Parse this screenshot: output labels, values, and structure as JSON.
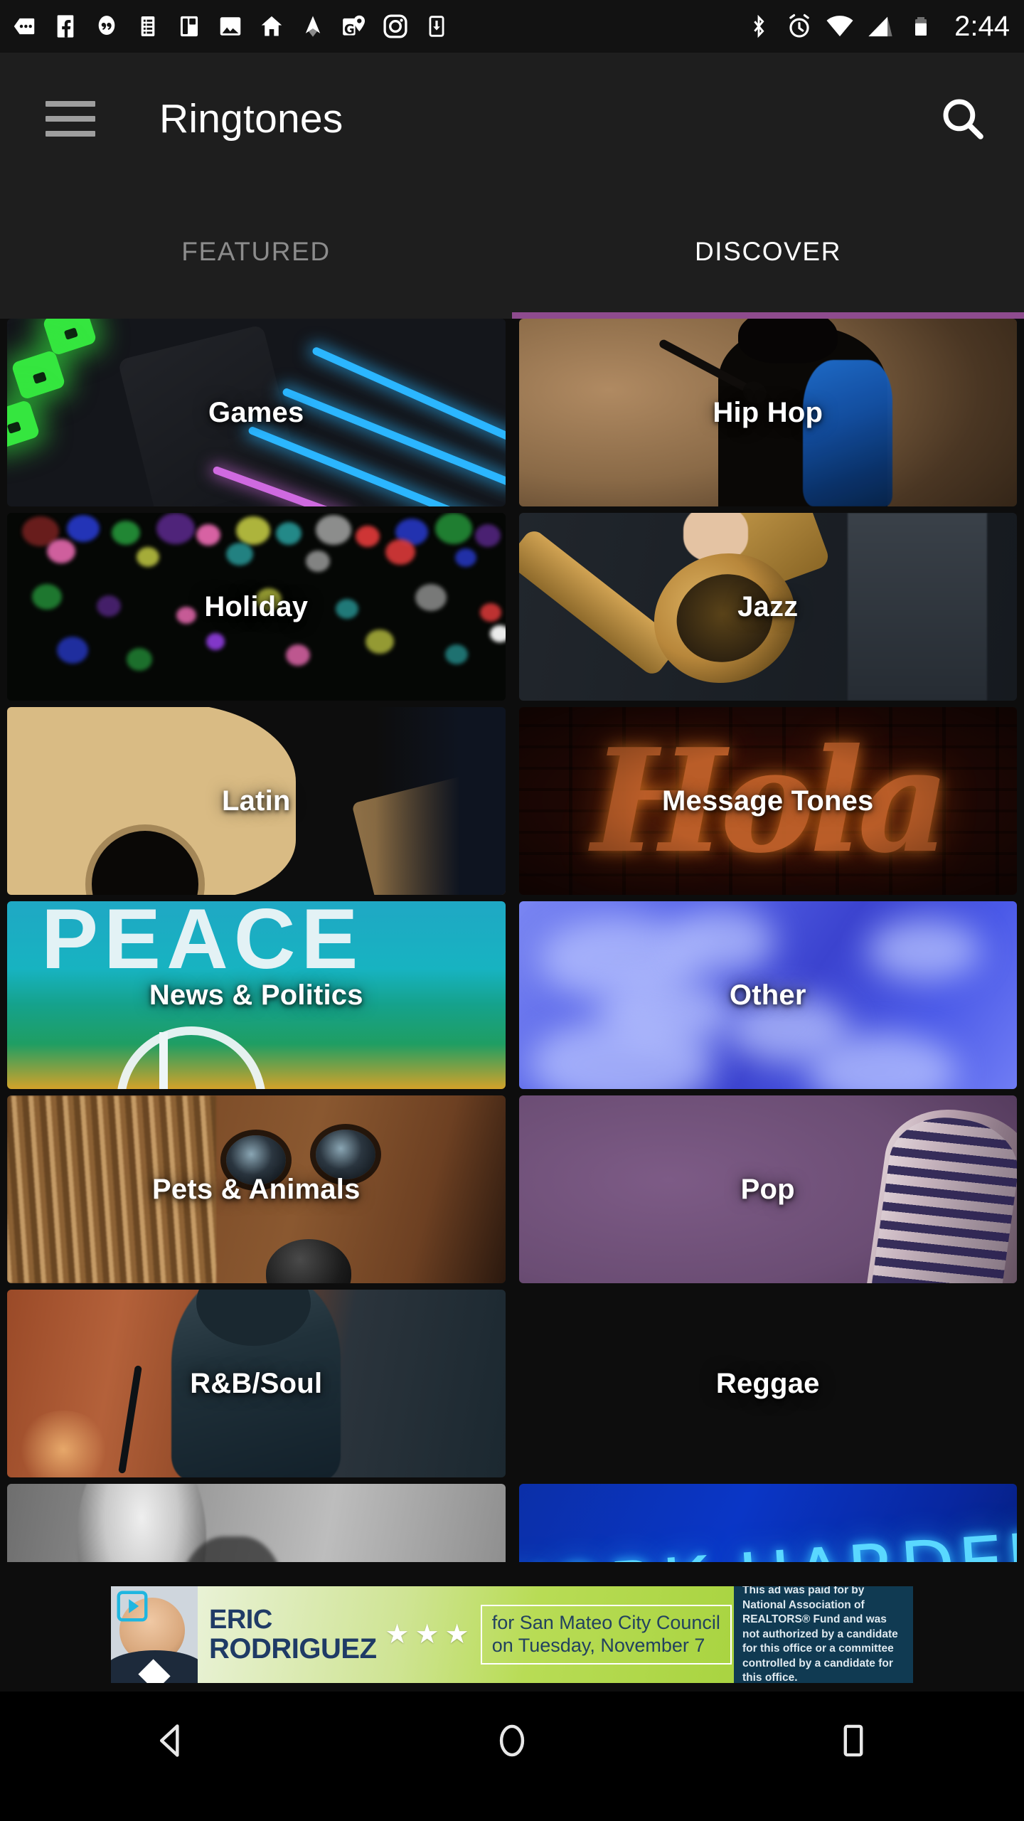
{
  "status_bar": {
    "clock": "2:44",
    "left_icons": [
      "messages-icon",
      "facebook-icon",
      "quote-bubble-icon",
      "list-icon",
      "layout-icon",
      "photos-icon",
      "home-icon",
      "nav-arrow-icon",
      "maps-icon",
      "instagram-icon",
      "download-icon"
    ],
    "right_icons": [
      "bluetooth-icon",
      "alarm-icon",
      "wifi-icon",
      "cell-signal-icon",
      "battery-icon"
    ]
  },
  "app_bar": {
    "title": "Ringtones",
    "menu_icon": "hamburger-menu-icon",
    "search_icon": "search-icon"
  },
  "tabs": {
    "items": [
      {
        "label": "FEATURED",
        "active": false
      },
      {
        "label": "DISCOVER",
        "active": true
      }
    ],
    "indicator_color": "#8e4b8e"
  },
  "grid": {
    "rows": [
      [
        {
          "label": "Games",
          "art": "games"
        },
        {
          "label": "Hip Hop",
          "art": "hiphop"
        }
      ],
      [
        {
          "label": "Holiday",
          "art": "holiday"
        },
        {
          "label": "Jazz",
          "art": "jazz"
        }
      ],
      [
        {
          "label": "Latin",
          "art": "latin"
        },
        {
          "label": "Message Tones",
          "art": "msg"
        }
      ],
      [
        {
          "label": "News & Politics",
          "art": "news"
        },
        {
          "label": "Other",
          "art": "other"
        }
      ],
      [
        {
          "label": "Pets & Animals",
          "art": "pets"
        },
        {
          "label": "Pop",
          "art": "pop"
        }
      ],
      [
        {
          "label": "R&B/Soul",
          "art": "rnb"
        },
        {
          "label": "Reggae",
          "art": "reggae"
        }
      ]
    ],
    "clipped_row": [
      {
        "label": "",
        "art": "rock"
      },
      {
        "label": "",
        "art": "work",
        "neon_text": "WORK HARDER"
      }
    ],
    "hola_marquee_text": "Hola",
    "peace_flag_text": "PEACE"
  },
  "ad": {
    "candidate_first": "ERIC",
    "candidate_last": "RODRIGUEZ",
    "stars": [
      "★",
      "★",
      "★"
    ],
    "cta_line1": "for San Mateo City Council",
    "cta_line2": "on Tuesday, November 7",
    "disclaimer": "This ad was paid for by National Association of REALTORS® Fund and was not authorized by a candidate for this office or a committee controlled by a candidate for this office.",
    "play_badge_icon": "ad-play-badge-icon"
  },
  "nav_bar": {
    "back_icon": "back-triangle-icon",
    "home_icon": "home-circle-icon",
    "recents_icon": "recents-square-icon"
  }
}
